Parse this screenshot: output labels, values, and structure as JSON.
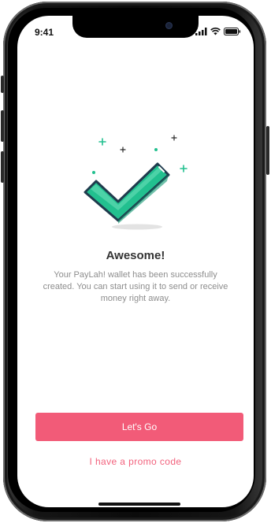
{
  "status_bar": {
    "time": "9:41",
    "icons": [
      "signal-icon",
      "wifi-icon",
      "battery-icon"
    ]
  },
  "illustration": {
    "icon": "checkmark-icon",
    "accent_color": "#22c08f"
  },
  "success": {
    "title": "Awesome!",
    "message": "Your PayLah! wallet has been successfully created. You can start using it to send or receive money right away."
  },
  "actions": {
    "primary_label": "Let's Go",
    "primary_color": "#f25b78",
    "promo_label": "I have a promo code"
  }
}
